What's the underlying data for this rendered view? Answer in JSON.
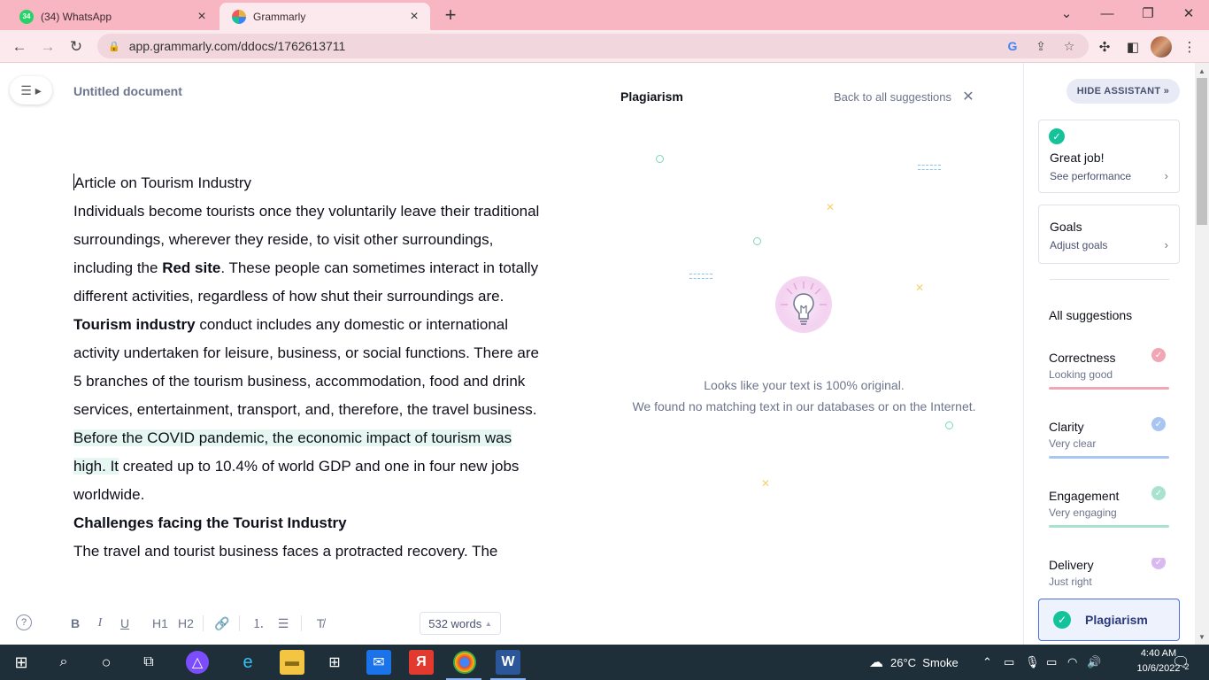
{
  "browser": {
    "tabs": [
      {
        "title": "(34) WhatsApp",
        "badge": "34",
        "active": false
      },
      {
        "title": "Grammarly",
        "active": true
      }
    ],
    "url": "app.grammarly.com/ddocs/1762613711"
  },
  "editor": {
    "doc_title": "Untitled document",
    "heading": "Article on Tourism Industry",
    "p1_part1": "Individuals become tourists once they voluntarily leave their traditional surroundings, wherever they reside, to visit other surroundings, including the ",
    "p1_bold1": "Red site",
    "p1_part2": ". These people can sometimes interact in totally different activities, regardless of how shut their surroundings are. ",
    "p1_bold2": "Tourism industry",
    "p1_part3": " conduct includes any domestic or international activity undertaken for leisure, business, or social functions. There are 5 branches of the tourism business, accommodation, food and drink services, entertainment, transport, and, therefore, the travel business. ",
    "p1_highlight": "Before the COVID pandemic, the economic impact of tourism was high. It",
    "p1_part4": " created up to 10.4% of world GDP and one in four new jobs worldwide.",
    "subheading": "Challenges facing the Tourist Industry",
    "p2": "The travel and tourist business faces a protracted recovery. The"
  },
  "toolbar": {
    "h1": "H1",
    "h2": "H2",
    "word_count": "532 words"
  },
  "plagiarism": {
    "title": "Plagiarism",
    "back_link": "Back to all suggestions",
    "message_line1": "Looks like your text is 100% original.",
    "message_line2": "We found no matching text in our databases or on the Internet."
  },
  "assistant": {
    "hide_label": "HIDE ASSISTANT",
    "performance_title": "Great job!",
    "performance_link": "See performance",
    "goals_title": "Goals",
    "goals_link": "Adjust goals",
    "all_suggestions": "All suggestions",
    "categories": [
      {
        "name": "Correctness",
        "status": "Looking good",
        "color": "#f0a6b5"
      },
      {
        "name": "Clarity",
        "status": "Very clear",
        "color": "#a9c6f2"
      },
      {
        "name": "Engagement",
        "status": "Very engaging",
        "color": "#a9e3cf"
      },
      {
        "name": "Delivery",
        "status": "Just right",
        "color": "#d9b9f0"
      }
    ],
    "plagiarism_button": "Plagiarism"
  },
  "taskbar": {
    "weather_temp": "26°C",
    "weather_text": "Smoke",
    "time": "4:40 AM",
    "date": "10/6/2022",
    "notifications": "2"
  }
}
